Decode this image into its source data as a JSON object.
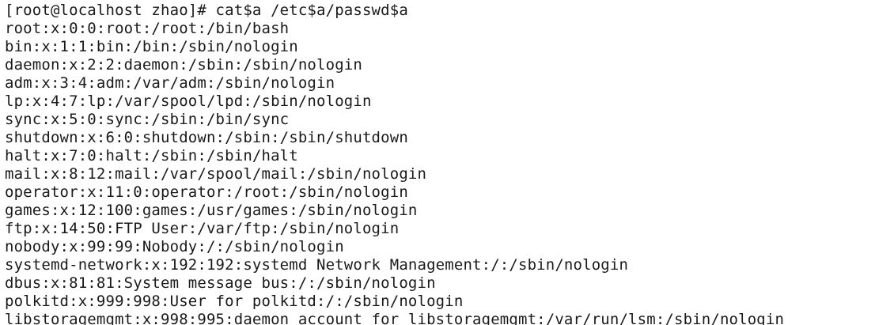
{
  "terminal": {
    "background": "#ffffff",
    "foreground": "#1a1a1a",
    "prompt": "[root@localhost zhao]# ",
    "command": "cat$a /etc$a/passwd$a",
    "output": [
      "root:x:0:0:root:/root:/bin/bash",
      "bin:x:1:1:bin:/bin:/sbin/nologin",
      "daemon:x:2:2:daemon:/sbin:/sbin/nologin",
      "adm:x:3:4:adm:/var/adm:/sbin/nologin",
      "lp:x:4:7:lp:/var/spool/lpd:/sbin/nologin",
      "sync:x:5:0:sync:/sbin:/bin/sync",
      "shutdown:x:6:0:shutdown:/sbin:/sbin/shutdown",
      "halt:x:7:0:halt:/sbin:/sbin/halt",
      "mail:x:8:12:mail:/var/spool/mail:/sbin/nologin",
      "operator:x:11:0:operator:/root:/sbin/nologin",
      "games:x:12:100:games:/usr/games:/sbin/nologin",
      "ftp:x:14:50:FTP User:/var/ftp:/sbin/nologin",
      "nobody:x:99:99:Nobody:/:/sbin/nologin",
      "systemd-network:x:192:192:systemd Network Management:/:/sbin/nologin",
      "dbus:x:81:81:System message bus:/:/sbin/nologin",
      "polkitd:x:999:998:User for polkitd:/:/sbin/nologin",
      "libstoragemgmt:x:998:995:daemon account for libstoragemgmt:/var/run/lsm:/sbin/nologin"
    ]
  }
}
